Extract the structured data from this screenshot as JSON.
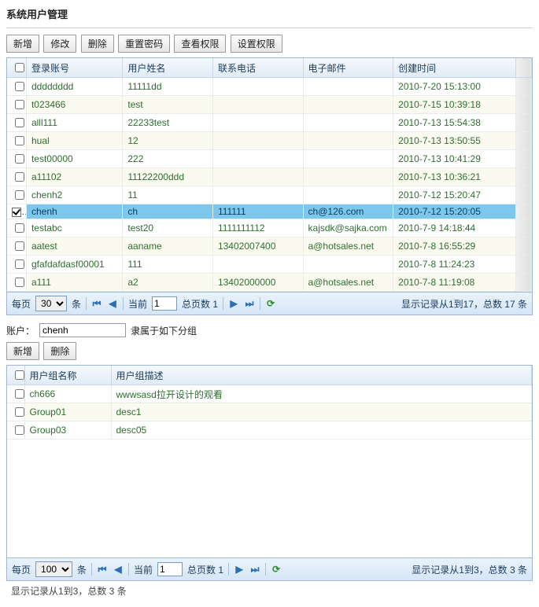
{
  "pageTitle": "系统用户管理",
  "toolbar": {
    "add": "新增",
    "edit": "修改",
    "del": "删除",
    "resetPwd": "重置密码",
    "viewPerm": "查看权限",
    "setPerm": "设置权限"
  },
  "grid1": {
    "headers": {
      "account": "登录账号",
      "name": "用户姓名",
      "phone": "联系电话",
      "email": "电子邮件",
      "created": "创建时间"
    },
    "rows": [
      {
        "acct": "dddddddd",
        "name": "11111dd",
        "phone": "",
        "email": "",
        "created": "2010-7-20 15:13:00",
        "checked": false
      },
      {
        "acct": "t023466",
        "name": "test",
        "phone": "",
        "email": "",
        "created": "2010-7-15 10:39:18",
        "checked": false
      },
      {
        "acct": "alll111",
        "name": "22233test",
        "phone": "",
        "email": "",
        "created": "2010-7-13 15:54:38",
        "checked": false
      },
      {
        "acct": "hual",
        "name": "12",
        "phone": "",
        "email": "",
        "created": "2010-7-13 13:50:55",
        "checked": false
      },
      {
        "acct": "test00000",
        "name": "222",
        "phone": "",
        "email": "",
        "created": "2010-7-13 10:41:29",
        "checked": false
      },
      {
        "acct": "a11102",
        "name": "11122200ddd",
        "phone": "",
        "email": "",
        "created": "2010-7-13 10:36:21",
        "checked": false
      },
      {
        "acct": "chenh2",
        "name": "11",
        "phone": "",
        "email": "",
        "created": "2010-7-12 15:20:47",
        "checked": false
      },
      {
        "acct": "chenh",
        "name": "ch",
        "phone": "111111",
        "email": "ch@126.com",
        "created": "2010-7-12 15:20:05",
        "checked": true
      },
      {
        "acct": "testabc",
        "name": "test20",
        "phone": "1111111112",
        "email": "kajsdk@sajka.com",
        "created": "2010-7-9 14:18:44",
        "checked": false
      },
      {
        "acct": "aatest",
        "name": "aaname",
        "phone": "13402007400",
        "email": "a@hotsales.net",
        "created": "2010-7-8 16:55:29",
        "checked": false
      },
      {
        "acct": "gfafdafdasf00001",
        "name": "111",
        "phone": "",
        "email": "",
        "created": "2010-7-8 11:24:23",
        "checked": false
      },
      {
        "acct": "a111",
        "name": "a2",
        "phone": "13402000000",
        "email": "a@hotsales.net",
        "created": "2010-7-8 11:19:08",
        "checked": false
      }
    ]
  },
  "pager1": {
    "perPage": "每页",
    "pageSize": "30",
    "unit": "条",
    "current": "当前",
    "page": "1",
    "totalPages": "总页数 1",
    "summary": "显示记录从1到17，总数 17 条"
  },
  "accountSection": {
    "label": "账户：",
    "value": "chenh",
    "belongs": "隶属于如下分组"
  },
  "toolbar2": {
    "add": "新增",
    "del": "删除"
  },
  "grid2": {
    "headers": {
      "gname": "用户组名称",
      "gdesc": "用户组描述"
    },
    "rows": [
      {
        "gname": "ch666",
        "gdesc": "wwwsasd拉开设计的观看"
      },
      {
        "gname": "Group01",
        "gdesc": "desc1"
      },
      {
        "gname": "Group03",
        "gdesc": "desc05"
      }
    ]
  },
  "pager2": {
    "perPage": "每页",
    "pageSize": "100",
    "unit": "条",
    "current": "当前",
    "page": "1",
    "totalPages": "总页数 1",
    "summary": "显示记录从1到3，总数 3 条"
  },
  "footer": {
    "summary": "显示记录从1到3，总数 3 条"
  }
}
